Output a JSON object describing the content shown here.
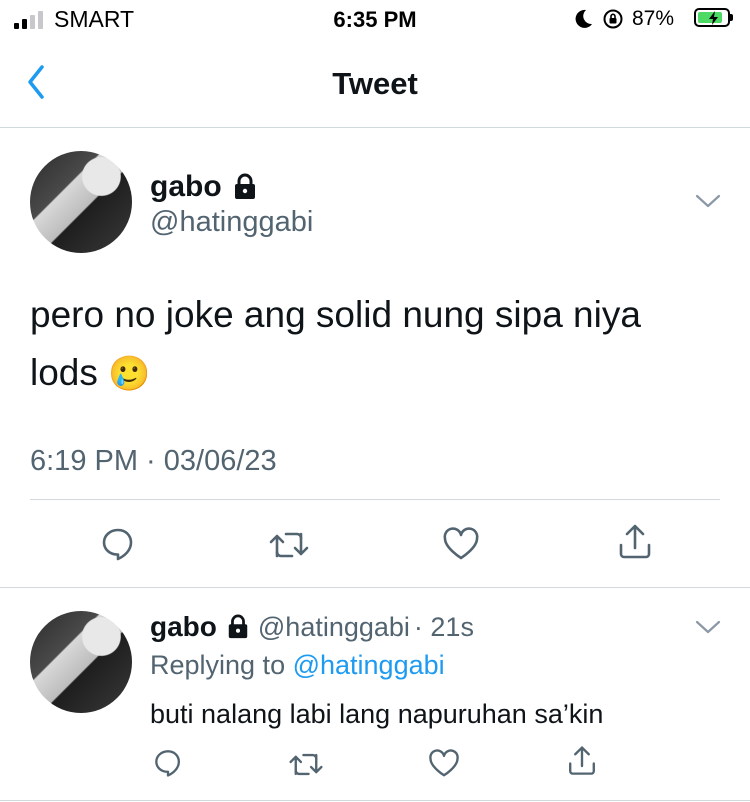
{
  "status_bar": {
    "carrier": "SMART",
    "time": "6:35 PM",
    "battery_percent": "87%",
    "battery_level": 0.87,
    "icons": [
      "signal-icon",
      "moon-icon",
      "orientation-lock-icon",
      "battery-charging-icon"
    ]
  },
  "nav": {
    "back_icon": "chevron-left-icon",
    "title": "Tweet"
  },
  "main_tweet": {
    "display_name": "gabo",
    "handle": "@hatinggabi",
    "locked_icon": "lock-icon",
    "text": "pero no joke ang solid nung sipa niya lods",
    "emoji": "🥲",
    "timestamp": "6:19 PM · 03/06/23",
    "actions": [
      "reply-icon",
      "retweet-icon",
      "like-icon",
      "share-icon"
    ]
  },
  "reply": {
    "display_name": "gabo",
    "handle": "@hatinggabi",
    "age": "· 21s",
    "replying_prefix": "Replying to ",
    "replying_handle": "@hatinggabi",
    "text": "buti nalang labi lang napuruhan sa’kin"
  },
  "colors": {
    "accent": "#1d9bf0",
    "text": "#0f1419",
    "secondary": "#536471",
    "divider": "#cfd9de",
    "battery": "#4cd964"
  }
}
